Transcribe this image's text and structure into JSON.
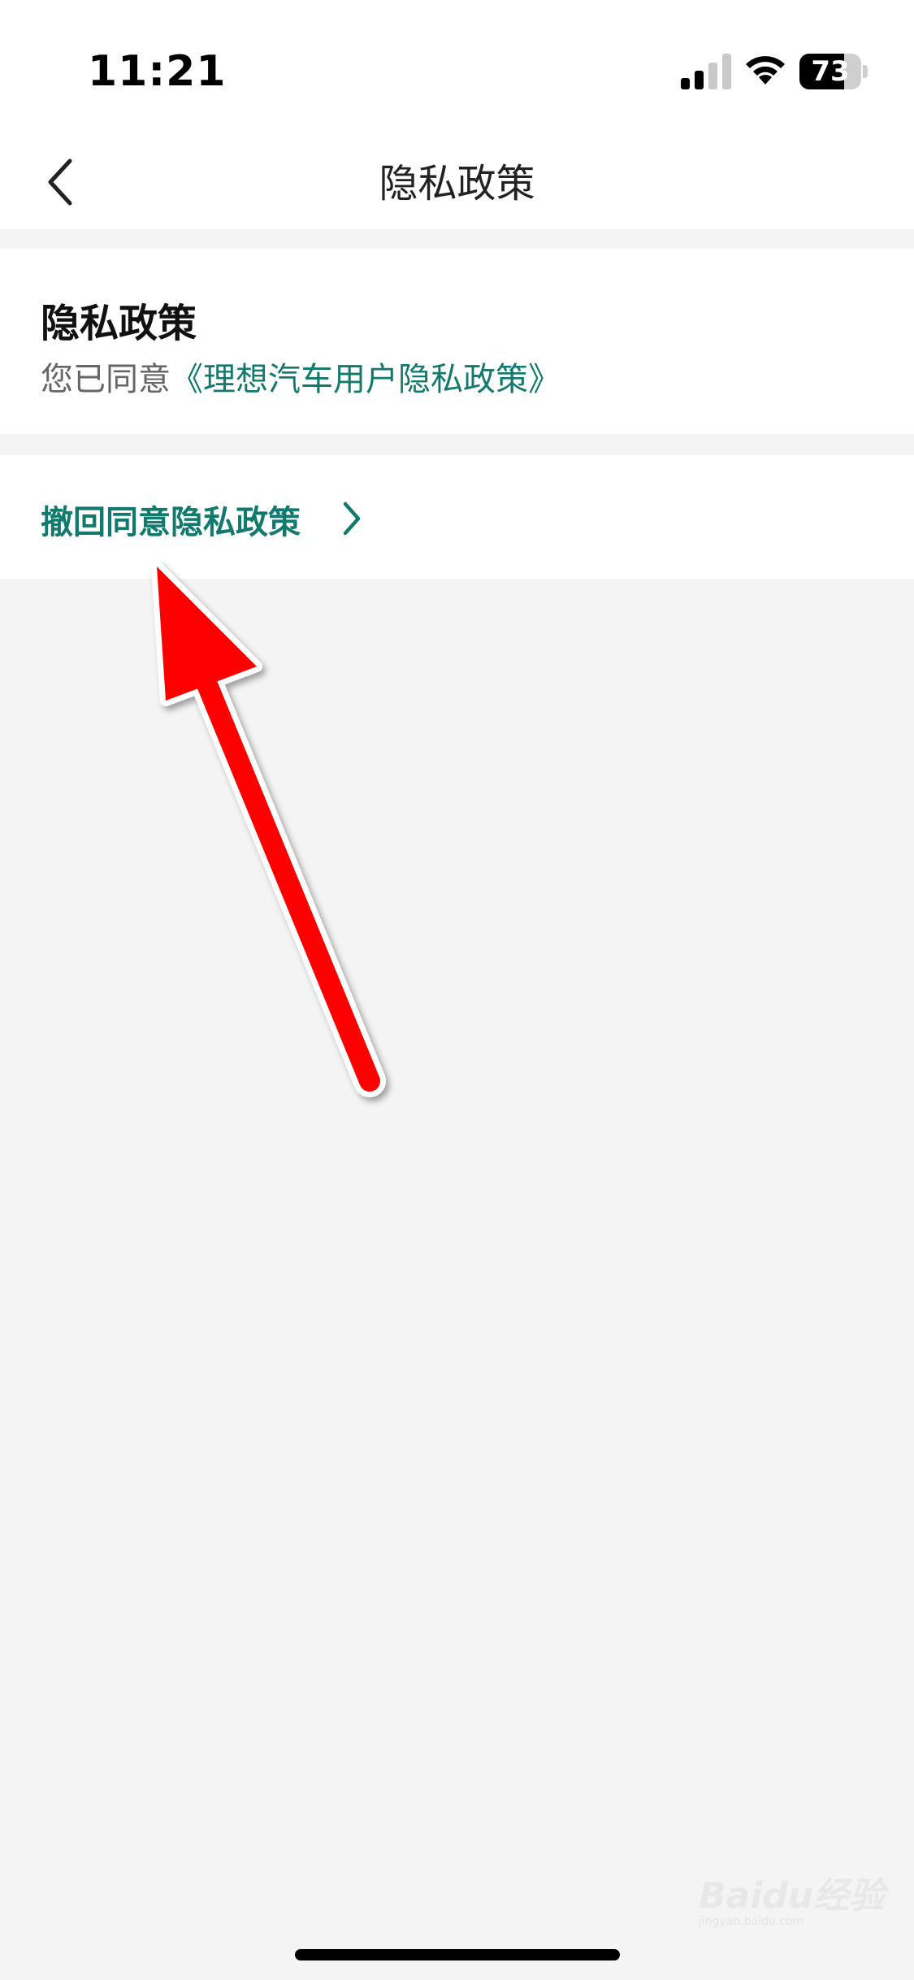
{
  "status_bar": {
    "time": "11:21",
    "battery_level": 73,
    "battery_label": "73",
    "signal_bars_active": 2,
    "signal_bars_total": 4
  },
  "nav": {
    "title": "隐私政策",
    "back_icon": "chevron-left-icon"
  },
  "policy_card": {
    "title": "隐私政策",
    "agreed_prefix": "您已同意",
    "policy_link": "《理想汽车用户隐私政策》"
  },
  "revoke": {
    "label": "撤回同意隐私政策",
    "icon": "chevron-right-icon"
  },
  "watermark": {
    "brand": "Baidu经验",
    "url": "jingyan.baidu.com"
  },
  "colors": {
    "accent": "#127a6c",
    "background": "#f4f4f4",
    "annotation_arrow": "#ff0000"
  }
}
